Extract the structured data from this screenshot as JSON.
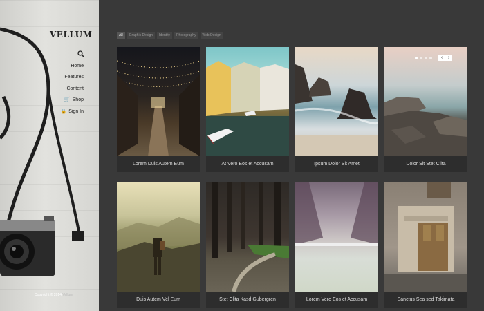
{
  "brand": {
    "name": "VELLUM"
  },
  "sidebar": {
    "search_icon": "search-icon",
    "nav": [
      {
        "label": "Home",
        "icon": ""
      },
      {
        "label": "Features",
        "icon": ""
      },
      {
        "label": "Content",
        "icon": ""
      },
      {
        "label": "Shop",
        "icon": "cart-icon"
      },
      {
        "label": "Sign In",
        "icon": "lock-icon"
      }
    ],
    "copyright": "Copyright © 2014",
    "copyright_author": "Vellum"
  },
  "filters": [
    "All",
    "Graphic Design",
    "Identity",
    "Photography",
    "Web Design"
  ],
  "active_filter": "All",
  "portfolio": [
    {
      "title": "Lorem Duis Autem Eum"
    },
    {
      "title": "At Vero Eos et Accusam"
    },
    {
      "title": "Ipsum Dolor Sit Amet"
    },
    {
      "title": "Dolor Sit Stet Clita"
    },
    {
      "title": "Duis Autem Vel Eum"
    },
    {
      "title": "Stet Clita Kasd Gubergren"
    },
    {
      "title": "Lorem Vero Eos et Accusam"
    },
    {
      "title": "Sanctus Sea sed Takimata"
    }
  ],
  "slider": {
    "prev": "‹",
    "next": "›"
  }
}
